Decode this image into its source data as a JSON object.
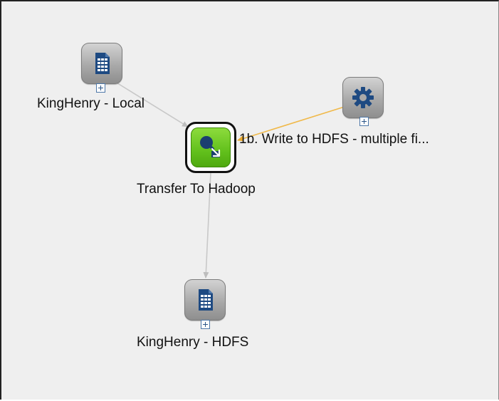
{
  "diagram": {
    "nodes": [
      {
        "id": "kinghenry-local",
        "label": "KingHenry - Local",
        "icon": "dataset-icon",
        "expandable": true
      },
      {
        "id": "transfer-to-hadoop",
        "label": "Transfer To Hadoop",
        "icon": "transfer-icon",
        "selected": true
      },
      {
        "id": "write-to-hdfs",
        "label": "1b. Write to HDFS - multiple fi...",
        "icon": "gear-icon",
        "expandable": true
      },
      {
        "id": "kinghenry-hdfs",
        "label": "KingHenry - HDFS",
        "icon": "dataset-icon",
        "expandable": true
      }
    ],
    "edges": [
      {
        "from": "kinghenry-local",
        "to": "transfer-to-hadoop",
        "color": "#c8c8c8"
      },
      {
        "from": "write-to-hdfs",
        "to": "transfer-to-hadoop",
        "color": "#f0b94a"
      },
      {
        "from": "transfer-to-hadoop",
        "to": "kinghenry-hdfs",
        "color": "#c8c8c8"
      }
    ]
  },
  "colors": {
    "canvas_background": "#efefef",
    "selected_node": "#62c01c",
    "dataset_icon": "#1e4a82",
    "gear_icon": "#1e4a82"
  }
}
